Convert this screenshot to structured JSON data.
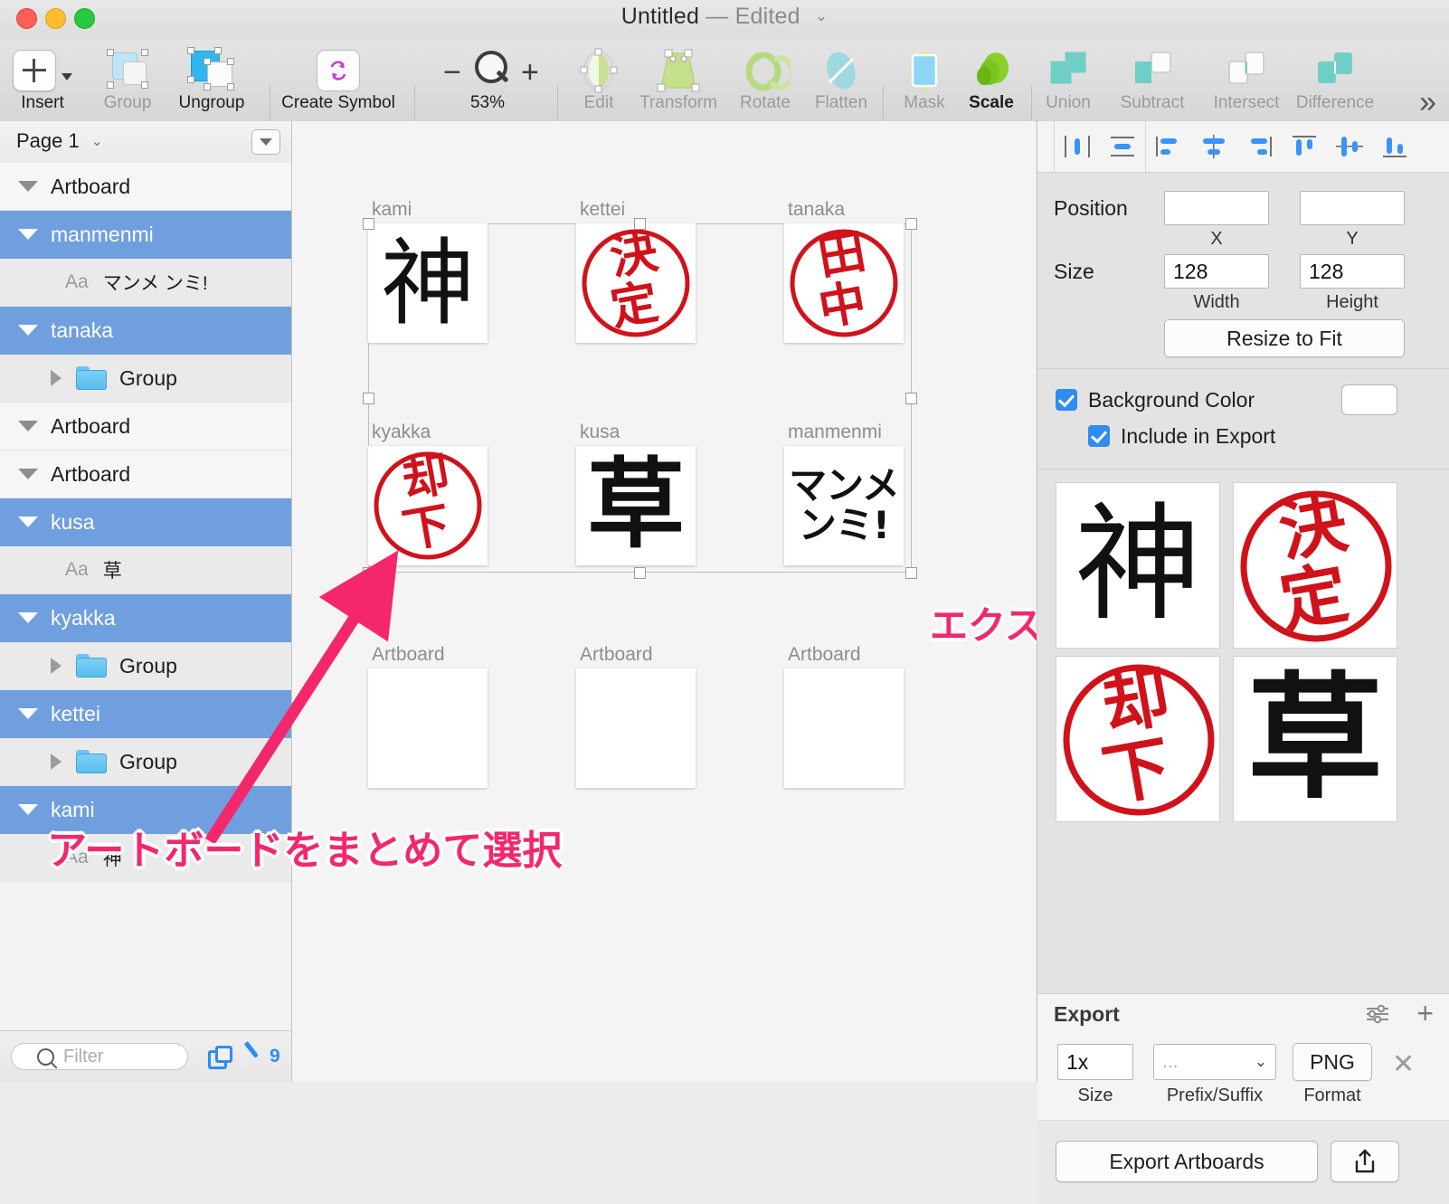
{
  "window": {
    "title": "Untitled",
    "dash": "—",
    "status": "Edited",
    "chevron": "chevron-down"
  },
  "toolbar": {
    "items": [
      {
        "label": "Insert",
        "icon": "plus-box-icon",
        "dimmed": false
      },
      {
        "label": "Group",
        "icon": "group-shapes-icon",
        "dimmed": true
      },
      {
        "label": "Ungroup",
        "icon": "ungroup-shapes-icon",
        "dimmed": false
      },
      {
        "label": "Create Symbol",
        "icon": "create-symbol-icon",
        "dimmed": false
      },
      {
        "label": "Edit",
        "icon": "edit-path-icon",
        "dimmed": true
      },
      {
        "label": "Transform",
        "icon": "transform-icon",
        "dimmed": true
      },
      {
        "label": "Rotate",
        "icon": "rotate-copies-icon",
        "dimmed": true
      },
      {
        "label": "Flatten",
        "icon": "flatten-icon",
        "dimmed": true
      },
      {
        "label": "Mask",
        "icon": "mask-icon",
        "dimmed": true
      },
      {
        "label": "Scale",
        "icon": "scale-icon",
        "dimmed": false
      },
      {
        "label": "Union",
        "icon": "union-icon",
        "dimmed": true
      },
      {
        "label": "Subtract",
        "icon": "subtract-icon",
        "dimmed": true
      },
      {
        "label": "Intersect",
        "icon": "intersect-icon",
        "dimmed": true
      },
      {
        "label": "Difference",
        "icon": "difference-icon",
        "dimmed": true
      }
    ],
    "zoom_level": "53%",
    "zoom_out": "−",
    "zoom_in": "+",
    "overflow": "»"
  },
  "sidebar": {
    "page_name": "Page 1",
    "page_menu_icon": "dropdown-menu-icon",
    "rows": [
      {
        "name": "Artboard",
        "type": "artboard",
        "selected": false,
        "indent": 0,
        "disclosure": "down"
      },
      {
        "name": "manmenmi",
        "type": "artboard",
        "selected": true,
        "indent": 0,
        "disclosure": "down"
      },
      {
        "name": "マンメ ンミ!",
        "type": "text",
        "selected": false,
        "indent": 1,
        "disclosure": "none"
      },
      {
        "name": "tanaka",
        "type": "artboard",
        "selected": true,
        "indent": 0,
        "disclosure": "down"
      },
      {
        "name": "Group",
        "type": "group",
        "selected": false,
        "indent": 1,
        "disclosure": "right"
      },
      {
        "name": "Artboard",
        "type": "artboard",
        "selected": false,
        "indent": 0,
        "disclosure": "down"
      },
      {
        "name": "Artboard",
        "type": "artboard",
        "selected": false,
        "indent": 0,
        "disclosure": "down"
      },
      {
        "name": "kusa",
        "type": "artboard",
        "selected": true,
        "indent": 0,
        "disclosure": "down"
      },
      {
        "name": "草",
        "type": "text",
        "selected": false,
        "indent": 1,
        "disclosure": "none"
      },
      {
        "name": "kyakka",
        "type": "artboard",
        "selected": true,
        "indent": 0,
        "disclosure": "down"
      },
      {
        "name": "Group",
        "type": "group",
        "selected": false,
        "indent": 1,
        "disclosure": "right"
      },
      {
        "name": "kettei",
        "type": "artboard",
        "selected": true,
        "indent": 0,
        "disclosure": "down"
      },
      {
        "name": "Group",
        "type": "group",
        "selected": false,
        "indent": 1,
        "disclosure": "right"
      },
      {
        "name": "kami",
        "type": "artboard",
        "selected": true,
        "indent": 0,
        "disclosure": "down"
      },
      {
        "name": "神",
        "type": "text",
        "selected": false,
        "indent": 1,
        "disclosure": "none"
      }
    ],
    "text_layer_badge": "Aa",
    "filter_placeholder": "Filter",
    "filter_value": "",
    "search_icon": "search-icon",
    "duplicate_icon": "duplicate-icon",
    "slice_icon": "slice-icon",
    "slice_count": "9"
  },
  "canvas": {
    "artboards": [
      {
        "label": "kami",
        "content": "神",
        "style": "plain-kanji",
        "empty": false
      },
      {
        "label": "kettei",
        "content": "決定",
        "style": "round-stamp",
        "empty": false
      },
      {
        "label": "tanaka",
        "content": "田中",
        "style": "round-stamp",
        "empty": false
      },
      {
        "label": "kyakka",
        "content": "却下",
        "style": "round-stamp",
        "empty": false
      },
      {
        "label": "kusa",
        "content": "草",
        "style": "plain-kanji",
        "empty": false
      },
      {
        "label": "manmenmi",
        "content": "マンメ ンミ!",
        "style": "bold-katakana",
        "empty": false
      },
      {
        "label": "Artboard",
        "content": "",
        "style": "empty",
        "empty": true
      },
      {
        "label": "Artboard",
        "content": "",
        "style": "empty",
        "empty": true
      },
      {
        "label": "Artboard",
        "content": "",
        "style": "empty",
        "empty": true
      }
    ],
    "annotations": [
      {
        "text": "アートボードをまとめて選択",
        "arrow": "arrow-up-right"
      },
      {
        "text": "エクスポート",
        "arrow": "arrow-down"
      }
    ]
  },
  "inspector": {
    "align_buttons": [
      "distribute-horizontally-icon",
      "distribute-vertically-icon",
      "align-left-icon",
      "align-center-horizontal-icon",
      "align-right-icon",
      "align-top-icon",
      "align-middle-vertical-icon",
      "align-bottom-icon"
    ],
    "position_label": "Position",
    "position_x": "",
    "position_y": "",
    "x_sub": "X",
    "y_sub": "Y",
    "size_label": "Size",
    "width_value": "128",
    "height_value": "128",
    "width_sub": "Width",
    "height_sub": "Height",
    "resize_to_fit": "Resize to Fit",
    "background_color_label": "Background Color",
    "background_color_checked": true,
    "background_color_swatch": "#ffffff",
    "include_in_export_label": "Include in Export",
    "include_in_export_checked": true,
    "previews": [
      {
        "content": "神",
        "style": "plain-kanji"
      },
      {
        "content": "決定",
        "style": "round-stamp"
      },
      {
        "content": "却下",
        "style": "round-stamp"
      },
      {
        "content": "草",
        "style": "plain-kanji"
      }
    ],
    "export": {
      "header": "Export",
      "settings_icon": "sliders-icon",
      "add_icon": "plus-icon",
      "size_value": "1x",
      "size_sub": "Size",
      "prefix_value": "...",
      "prefix_sub": "Prefix/Suffix",
      "format_value": "PNG",
      "format_sub": "Format",
      "remove_icon": "close-icon",
      "export_button": "Export Artboards",
      "share_icon": "share-icon"
    }
  },
  "colors": {
    "selection_blue": "#6f9fdf",
    "accent_blue": "#2f8cf0",
    "stamp_red": "#d0121b",
    "annotation_pink": "#f4276c"
  }
}
